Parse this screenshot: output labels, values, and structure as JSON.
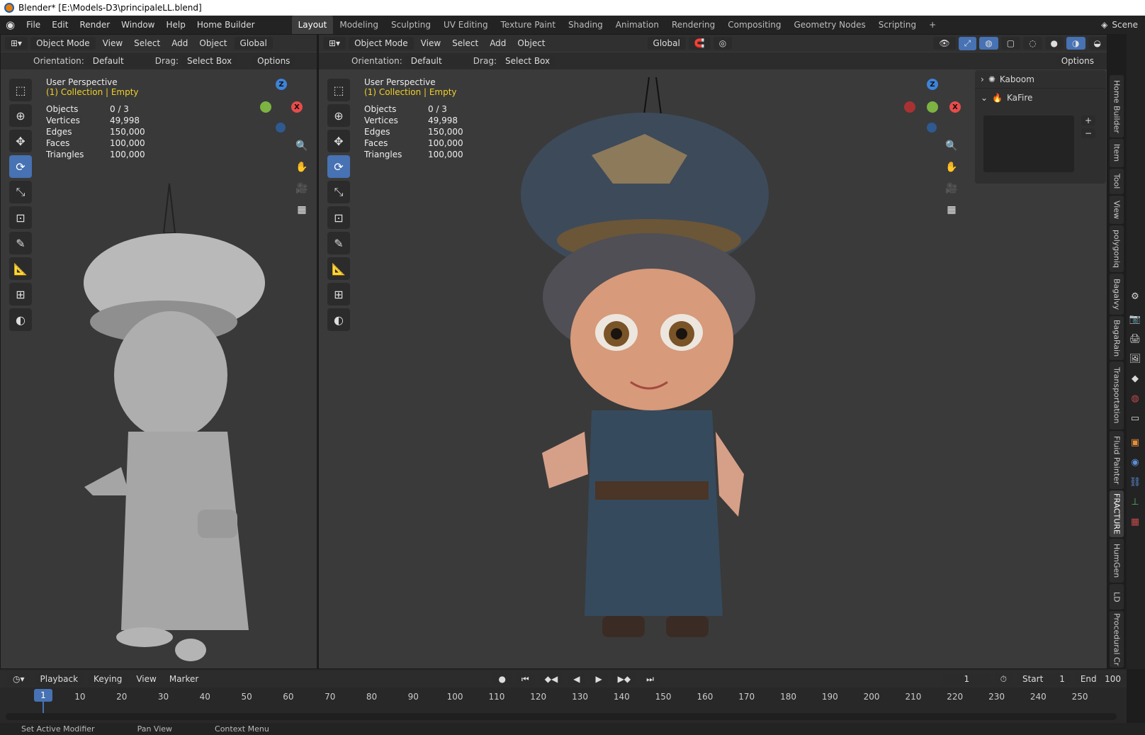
{
  "window_title": "Blender* [E:\\Models-D3\\principaleLL.blend]",
  "menu": [
    "File",
    "Edit",
    "Render",
    "Window",
    "Help",
    "Home Builder"
  ],
  "workspaces": [
    "Layout",
    "Modeling",
    "Sculpting",
    "UV Editing",
    "Texture Paint",
    "Shading",
    "Animation",
    "Rendering",
    "Compositing",
    "Geometry Nodes",
    "Scripting"
  ],
  "active_workspace": "Layout",
  "scene_label": "Scene",
  "viewport_header": {
    "mode": "Object Mode",
    "view": "View",
    "select": "Select",
    "add": "Add",
    "object": "Object",
    "transform_orientation": "Global",
    "orientation_label": "Orientation:",
    "orientation_value": "Default",
    "drag_label": "Drag:",
    "drag_value": "Select Box",
    "options": "Options"
  },
  "overlay": {
    "perspective": "User Perspective",
    "collection": "(1) Collection | Empty",
    "stats": [
      {
        "label": "Objects",
        "value": "0 / 3"
      },
      {
        "label": "Vertices",
        "value": "49,998"
      },
      {
        "label": "Edges",
        "value": "150,000"
      },
      {
        "label": "Faces",
        "value": "100,000"
      },
      {
        "label": "Triangles",
        "value": "100,000"
      }
    ]
  },
  "gizmo": {
    "z": "Z",
    "x": "X",
    "colors": {
      "x": "#e94b4b",
      "y": "#7cb342",
      "z": "#3d83d9"
    }
  },
  "npanel": {
    "items": [
      {
        "label": "Kaboom",
        "expanded": false
      },
      {
        "label": "KaFire",
        "expanded": true
      }
    ]
  },
  "side_tabs": [
    "Home Builder",
    "Item",
    "Tool",
    "View",
    "polygoniq",
    "Bagalvy",
    "BagaRain",
    "Transportation",
    "Fluid Painter",
    "FRACTURE",
    "HumGen",
    "LD",
    "Procedural Cr"
  ],
  "timeline": {
    "playback": "Playback",
    "keying": "Keying",
    "view": "View",
    "marker": "Marker",
    "current_frame": "1",
    "start_label": "Start",
    "start_value": "1",
    "end_label": "End",
    "end_value": "100",
    "ticks": [
      "1",
      "10",
      "20",
      "30",
      "40",
      "50",
      "60",
      "70",
      "80",
      "90",
      "100",
      "110",
      "120",
      "130",
      "140",
      "150",
      "160",
      "170",
      "180",
      "190",
      "200",
      "210",
      "220",
      "230",
      "240",
      "250"
    ]
  },
  "status": [
    "Set Active Modifier",
    "Pan View",
    "Context Menu"
  ],
  "accent_color": "#4772b3"
}
